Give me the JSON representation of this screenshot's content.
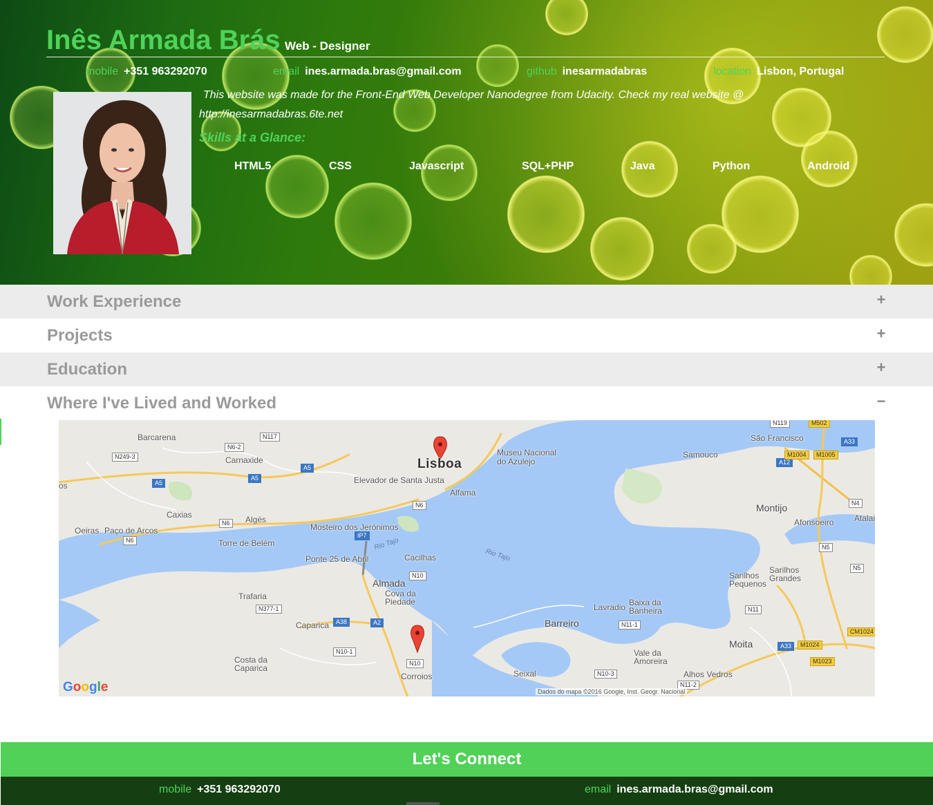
{
  "header": {
    "name": "Inês Armada Brás",
    "role": "Web - Designer",
    "contacts": [
      {
        "label": "mobile",
        "value": "+351 963292070"
      },
      {
        "label": "email",
        "value": "ines.armada.bras@gmail.com"
      },
      {
        "label": "github",
        "value": "inesarmadabras"
      },
      {
        "label": "location",
        "value": "Lisbon, Portugal"
      }
    ],
    "welcome": "This website was made for the Front-End Web Developer Nanodegree from Udacity. Check my real website @ http://inesarmadabras.6te.net",
    "skills_heading": "Skills at a Glance:",
    "skills": [
      "HTML5",
      "CSS",
      "Javascript",
      "SQL+PHP",
      "Java",
      "Python",
      "Android"
    ]
  },
  "sections": [
    {
      "title": "Work Experience",
      "toggle": "+"
    },
    {
      "title": "Projects",
      "toggle": "+"
    },
    {
      "title": "Education",
      "toggle": "+"
    },
    {
      "title": "Where I've Lived and Worked",
      "toggle": "−"
    }
  ],
  "map": {
    "places": [
      "Barcarena",
      "Carnaxide",
      "Lisboa",
      "Museu Nacional do Azulejo",
      "Elevador de Santa Justa",
      "Alfama",
      "Caxias",
      "Algés",
      "Oeiras",
      "Paço de Arcos",
      "Mosteiro dos Jerónimos",
      "Torre de Belém",
      "Ponte 25 de Abril",
      "Cacilhas",
      "Almada",
      "Cova da Piedade",
      "Trafaria",
      "Caparica",
      "Costa da Caparica",
      "Corroios",
      "Seixal",
      "Barreiro",
      "Lavradio",
      "Baixa da Banheira",
      "Vale da Amoreira",
      "Moita",
      "Alhos Vedros",
      "Montijo",
      "Afonsoeiro",
      "Atalaia",
      "Samouco",
      "São Francisco",
      "Sarilhos Pequenos",
      "Sarilhos Grandes",
      "os",
      "Rio Tajo"
    ],
    "roads": [
      "N117",
      "N6-2",
      "N249-3",
      "A5",
      "N6",
      "IP7",
      "N10",
      "N377-1",
      "A38",
      "A2",
      "N10-1",
      "N11-1",
      "N10-3",
      "N11-2",
      "N11",
      "A33",
      "M1024",
      "M1023",
      "CM1024",
      "N4",
      "N5",
      "A12",
      "M1004",
      "M1005",
      "N119",
      "M502"
    ],
    "logo": "Google",
    "attribution": "Dados do mapa ©2016 Google, Inst. Geogr. Nacional"
  },
  "footer": {
    "title": "Let's Connect",
    "contacts": [
      {
        "label": "mobile",
        "value": "+351 963292070"
      },
      {
        "label": "email",
        "value": "ines.armada.bras@gmail.com"
      }
    ]
  }
}
